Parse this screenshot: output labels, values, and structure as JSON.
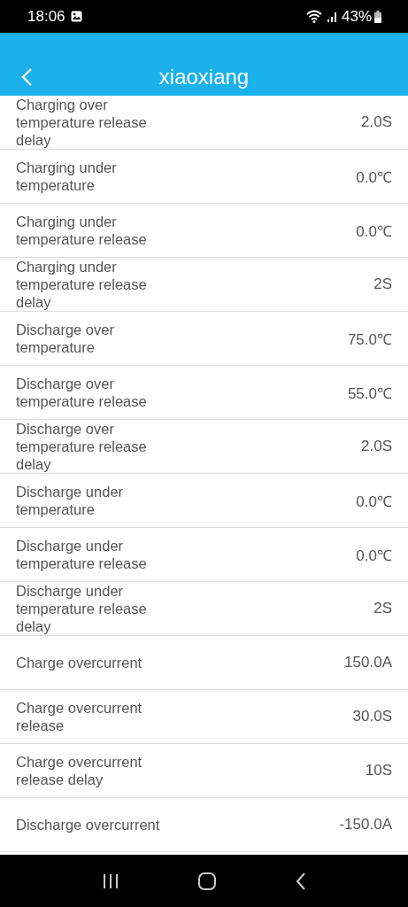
{
  "status_bar": {
    "time": "18:06",
    "battery": "43%"
  },
  "header": {
    "title": "xiaoxiang"
  },
  "settings": [
    {
      "label": "Charging over temperature release delay",
      "value": "2.0S"
    },
    {
      "label": "Charging under temperature",
      "value": "0.0℃"
    },
    {
      "label": "Charging under temperature release",
      "value": "0.0℃"
    },
    {
      "label": "Charging under temperature release delay",
      "value": "2S"
    },
    {
      "label": "Discharge over temperature",
      "value": "75.0℃"
    },
    {
      "label": "Discharge over temperature release",
      "value": "55.0℃"
    },
    {
      "label": "Discharge over temperature release delay",
      "value": "2.0S"
    },
    {
      "label": "Discharge under temperature",
      "value": "0.0℃"
    },
    {
      "label": "Discharge under temperature release",
      "value": "0.0℃"
    },
    {
      "label": "Discharge under temperature release delay",
      "value": "2S"
    },
    {
      "label": "Charge overcurrent",
      "value": "150.0A"
    },
    {
      "label": "Charge overcurrent release",
      "value": "30.0S"
    },
    {
      "label": "Charge overcurrent release delay",
      "value": "10S"
    },
    {
      "label": "Discharge overcurrent",
      "value": "-150.0A"
    }
  ]
}
